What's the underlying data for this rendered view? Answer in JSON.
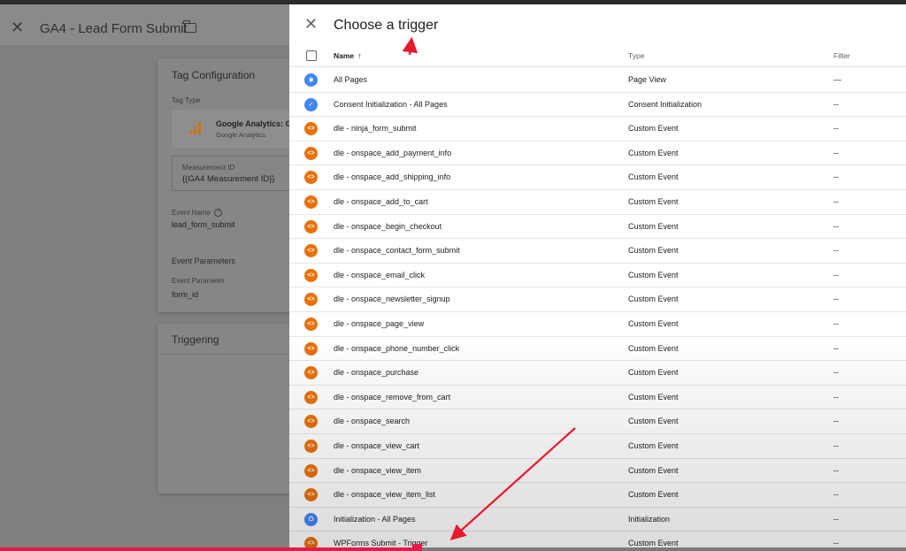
{
  "background": {
    "close_glyph": "✕",
    "tag_title": "GA4 - Lead Form Submit",
    "folder_icon": "folder-icon",
    "config_card": {
      "title": "Tag Configuration",
      "tag_type_label": "Tag Type",
      "tag_type_name": "Google Analytics: G",
      "tag_type_sub": "Google Analytics",
      "measurement_label": "Measurement ID",
      "measurement_value": "{{GA4 Measurement ID}}",
      "event_name_label": "Event Name",
      "event_name_value": "lead_form_submit",
      "event_params_label": "Event Parameters",
      "event_param_label": "Event Parameter",
      "event_param_value": "form_id"
    },
    "triggering_card": {
      "title": "Triggering"
    }
  },
  "panel": {
    "close_glyph": "✕",
    "title": "Choose a trigger",
    "columns": {
      "name": "Name",
      "sort_glyph": "↑",
      "type": "Type",
      "filter": "Filter"
    },
    "rows": [
      {
        "icon": "eye-icon",
        "color": "blue",
        "name": "All Pages",
        "type": "Page View",
        "filter": "—"
      },
      {
        "icon": "consent-icon",
        "color": "blue",
        "name": "Consent Initialization - All Pages",
        "type": "Consent Initialization",
        "filter": "--"
      },
      {
        "icon": "code-icon",
        "color": "orange",
        "name": "dle - ninja_form_submit",
        "type": "Custom Event",
        "filter": "--"
      },
      {
        "icon": "code-icon",
        "color": "orange",
        "name": "dle - onspace_add_payment_info",
        "type": "Custom Event",
        "filter": "--"
      },
      {
        "icon": "code-icon",
        "color": "orange",
        "name": "dle - onspace_add_shipping_info",
        "type": "Custom Event",
        "filter": "--"
      },
      {
        "icon": "code-icon",
        "color": "orange",
        "name": "dle - onspace_add_to_cart",
        "type": "Custom Event",
        "filter": "--"
      },
      {
        "icon": "code-icon",
        "color": "orange",
        "name": "dle - onspace_begin_checkout",
        "type": "Custom Event",
        "filter": "--"
      },
      {
        "icon": "code-icon",
        "color": "orange",
        "name": "dle - onspace_contact_form_submit",
        "type": "Custom Event",
        "filter": "--"
      },
      {
        "icon": "code-icon",
        "color": "orange",
        "name": "dle - onspace_email_click",
        "type": "Custom Event",
        "filter": "--"
      },
      {
        "icon": "code-icon",
        "color": "orange",
        "name": "dle - onspace_newsletter_signup",
        "type": "Custom Event",
        "filter": "--"
      },
      {
        "icon": "code-icon",
        "color": "orange",
        "name": "dle - onspace_page_view",
        "type": "Custom Event",
        "filter": "--"
      },
      {
        "icon": "code-icon",
        "color": "orange",
        "name": "dle - onspace_phone_number_click",
        "type": "Custom Event",
        "filter": "--"
      },
      {
        "icon": "code-icon",
        "color": "orange",
        "name": "dle - onspace_purchase",
        "type": "Custom Event",
        "filter": "--"
      },
      {
        "icon": "code-icon",
        "color": "orange",
        "name": "dle - onspace_remove_from_cart",
        "type": "Custom Event",
        "filter": "--"
      },
      {
        "icon": "code-icon",
        "color": "orange",
        "name": "dle - onspace_search",
        "type": "Custom Event",
        "filter": "--"
      },
      {
        "icon": "code-icon",
        "color": "orange",
        "name": "dle - onspace_view_cart",
        "type": "Custom Event",
        "filter": "--"
      },
      {
        "icon": "code-icon",
        "color": "orange",
        "name": "dle - onspace_view_item",
        "type": "Custom Event",
        "filter": "--"
      },
      {
        "icon": "code-icon",
        "color": "orange",
        "name": "dle - onspace_view_item_list",
        "type": "Custom Event",
        "filter": "--"
      },
      {
        "icon": "power-icon",
        "color": "blue",
        "name": "Initialization - All Pages",
        "type": "Initialization",
        "filter": "--"
      },
      {
        "icon": "code-icon",
        "color": "orange",
        "name": "WPForms Submit - Trigger",
        "type": "Custom Event",
        "filter": "--"
      }
    ]
  },
  "colors": {
    "orange": "#e8710a",
    "blue": "#4285f4",
    "annotation_red": "#e8192c"
  },
  "video_progress": 0.46
}
